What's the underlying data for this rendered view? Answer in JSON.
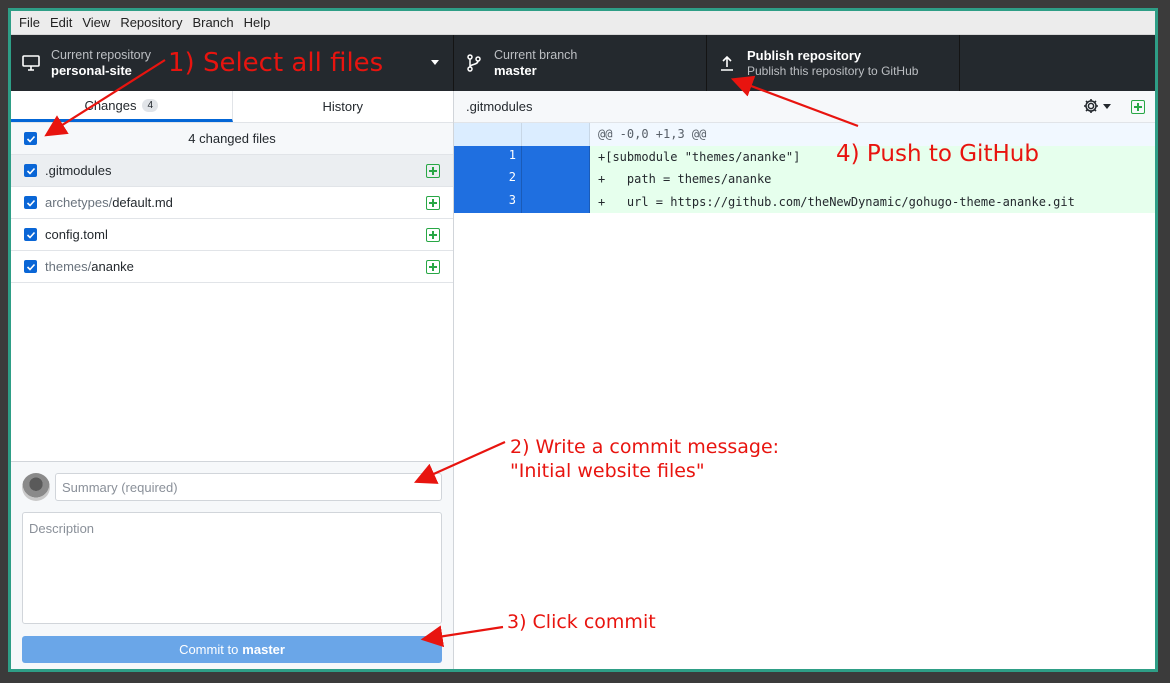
{
  "menu": [
    "File",
    "Edit",
    "View",
    "Repository",
    "Branch",
    "Help"
  ],
  "toolbar": {
    "repo_label": "Current repository",
    "repo_name": "personal-site",
    "branch_label": "Current branch",
    "branch_name": "master",
    "publish_title": "Publish repository",
    "publish_sub": "Publish this repository to GitHub"
  },
  "tabs": {
    "changes": "Changes",
    "changes_count": "4",
    "history": "History"
  },
  "changes": {
    "header": "4 changed files",
    "files": [
      {
        "dir": "",
        "name": ".gitmodules"
      },
      {
        "dir": "archetypes/",
        "name": "default.md"
      },
      {
        "dir": "",
        "name": "config.toml"
      },
      {
        "dir": "themes/",
        "name": "ananke"
      }
    ]
  },
  "commit": {
    "summary_placeholder": "Summary (required)",
    "description_placeholder": "Description",
    "button_prefix": "Commit to",
    "button_branch": "master"
  },
  "diff": {
    "file": ".gitmodules",
    "hunk": "@@ -0,0 +1,3 @@",
    "lines": [
      {
        "num": "1",
        "text": "+[submodule \"themes/ananke\"]"
      },
      {
        "num": "2",
        "text": "+   path = themes/ananke"
      },
      {
        "num": "3",
        "text": "+   url = https://github.com/theNewDynamic/gohugo-theme-ananke.git"
      }
    ]
  },
  "annotations": {
    "step1": "1) Select all files",
    "step2_line1": "2) Write  a commit message:",
    "step2_line2": "\"Initial website files\"",
    "step3": "3) Click commit",
    "step4": "4) Push to GitHub"
  },
  "colors": {
    "accent": "#0366d6",
    "annotation": "#e8140f",
    "toolbar": "#24292e",
    "frame": "#2e9e86"
  },
  "icons": [
    "computer-icon",
    "branch-icon",
    "upload-icon",
    "gear-icon",
    "add-file-icon",
    "checkbox-icon"
  ]
}
